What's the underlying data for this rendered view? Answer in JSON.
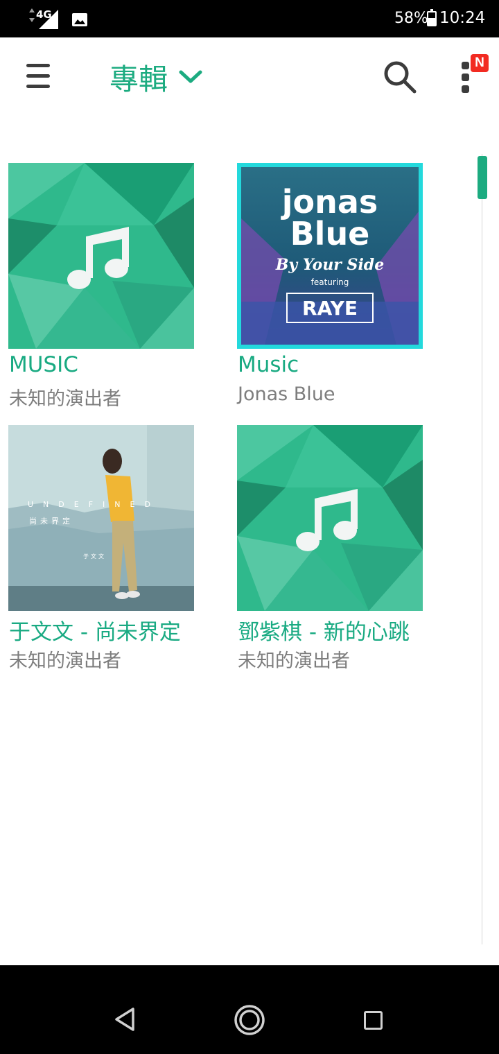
{
  "status_bar": {
    "network_label": "4G",
    "battery_percent": "58%",
    "battery_level": 0.58,
    "time": "10:24",
    "icons": [
      "signal-icon",
      "image-notification-icon",
      "battery-icon"
    ]
  },
  "app_bar": {
    "title": "專輯",
    "badge": "N",
    "icons": [
      "menu-icon",
      "chevron-down-icon",
      "search-icon",
      "more-vert-icon"
    ]
  },
  "albums": [
    {
      "title": "MUSIC",
      "artist": "未知的演出者",
      "cover": "default-music-cover"
    },
    {
      "title": "Music",
      "artist": "Jonas Blue",
      "cover": "jonas-blue-cover",
      "cover_text": {
        "line1": "jonas",
        "line2": "Blue",
        "subtitle": "By Your Side",
        "featuring": "featuring",
        "feature_artist": "RAYE"
      }
    },
    {
      "title": "于文文 - 尚未界定",
      "artist": "未知的演出者",
      "cover": "wenwen-cover",
      "cover_text": {
        "heading": "UNDEFINED",
        "title": "尚未界定",
        "artist": "于文文"
      }
    },
    {
      "title": "鄧紫棋 - 新的心跳",
      "artist": "未知的演出者",
      "cover": "default-music-cover"
    }
  ],
  "colors": {
    "accent": "#1cab80",
    "artist_text": "#7d7d7d",
    "badge": "#f22b22"
  },
  "scroll": {
    "position": 0.0
  }
}
